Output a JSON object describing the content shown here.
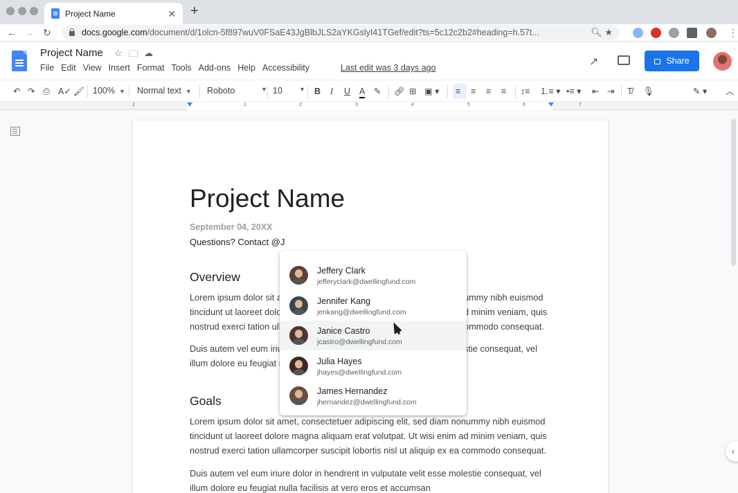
{
  "browser": {
    "tab_title": "Project Name",
    "tab_close": "✕",
    "new_tab": "+",
    "url_host": "docs.google.com",
    "url_path": "/document/d/1olcn-5f897wuV0FSaE43JgBlbJLS2aYKGslyI41TGef/edit?ts=5c12c2b2#heading=h.57t..."
  },
  "docs": {
    "title": "Project Name",
    "menu": [
      "File",
      "Edit",
      "View",
      "Insert",
      "Format",
      "Tools",
      "Add-ons",
      "Help",
      "Accessibility"
    ],
    "last_edit": "Last edit was 3 days ago",
    "share_label": "Share"
  },
  "toolbar": {
    "zoom": "100%",
    "style": "Normal text",
    "font": "Roboto",
    "size": "10"
  },
  "ruler": [
    "1",
    "1",
    "2",
    "3",
    "4",
    "5",
    "6",
    "7"
  ],
  "document": {
    "heading": "Project Name",
    "date": "September 04, 20XX",
    "contact": "Questions? Contact @J",
    "overview_title": "Overview",
    "overview_p1": [
      "Lorem ipsum dolor sit a",
      "tincidunt ut laoreet dolo",
      "nostrud exerci tation ull"
    ],
    "overview_p1_right": [
      "ummy nibh euismod",
      "d minim veniam, quis",
      "ommodo consequat."
    ],
    "overview_p2": [
      "Duis autem vel eum iriu",
      "illum dolore eu feugiat n"
    ],
    "overview_p2_right": [
      "stie consequat, vel"
    ],
    "goals_title": "Goals",
    "goals_p1": [
      "Lorem ipsum dolor sit amet, consectetuer adipiscing elit, sed diam nonummy nibh euismod",
      "tincidunt ut laoreet dolore magna aliquam erat volutpat. Ut wisi enim ad minim veniam, quis",
      "nostrud exerci tation ullamcorper suscipit lobortis nisl ut aliquip ex ea commodo consequat."
    ],
    "goals_p2": [
      "Duis autem vel eum iriure dolor in hendrerit in vulputate velit esse molestie consequat, vel",
      "illum dolore eu feugiat nulla facilisis at vero eros et accumsan"
    ]
  },
  "mentions": [
    {
      "name": "Jeffery Clark",
      "email": "jefferyclark@dwellingfund.com",
      "avatar": "#5d4037"
    },
    {
      "name": "Jennifer Kang",
      "email": "jenkang@dwellingfund.com",
      "avatar": "#37474f"
    },
    {
      "name": "Janice Castro",
      "email": "jcastro@dwellingfund.com",
      "avatar": "#4e342e"
    },
    {
      "name": "Julia Hayes",
      "email": "jhayes@dwellingfund.com",
      "avatar": "#3e2723"
    },
    {
      "name": "James Hernandez",
      "email": "jhernandez@dwellingfund.com",
      "avatar": "#6d4c41"
    }
  ],
  "highlighted_mention_index": 2,
  "colors": {
    "accent": "#1a73e8",
    "docs_blue": "#4285f4"
  }
}
